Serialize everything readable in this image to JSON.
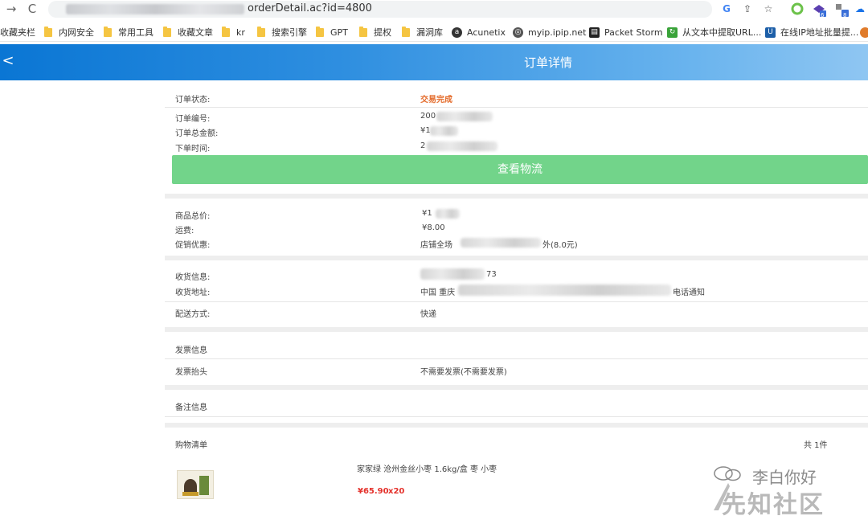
{
  "browser": {
    "url_visible": "orderDetail.ac?id=4800",
    "nav": {
      "forward": "→",
      "reload": "C"
    },
    "badges": {
      "ext1": "6",
      "ext2": "8"
    }
  },
  "bookmarks": [
    {
      "label": "收藏夹栏",
      "icon": "none"
    },
    {
      "label": "内网安全",
      "icon": "folder"
    },
    {
      "label": "常用工具",
      "icon": "folder"
    },
    {
      "label": "收藏文章",
      "icon": "folder"
    },
    {
      "label": "kr",
      "icon": "folder"
    },
    {
      "label": "搜索引擎",
      "icon": "folder"
    },
    {
      "label": "GPT",
      "icon": "folder"
    },
    {
      "label": "提权",
      "icon": "folder"
    },
    {
      "label": "漏洞库",
      "icon": "folder"
    },
    {
      "label": "Acunetix",
      "icon": "acunetix-icon"
    },
    {
      "label": "myip.ipip.net",
      "icon": "globe-icon"
    },
    {
      "label": "Packet Storm",
      "icon": "packetstorm-icon"
    },
    {
      "label": "从文本中提取URL...",
      "icon": "green-icon"
    },
    {
      "label": "在线IP地址批量提...",
      "icon": "u-icon"
    }
  ],
  "header": {
    "title": "订单详情",
    "back": "<"
  },
  "order": {
    "status_label": "订单状态:",
    "status_value": "交易完成",
    "number_label": "订单编号:",
    "number_value": "200",
    "total_label": "订单总金额:",
    "total_value": "¥1",
    "time_label": "下单时间:",
    "time_value": "2",
    "logistics_button": "查看物流"
  },
  "pricing": {
    "goods_total_label": "商品总价:",
    "goods_total_value": "¥1",
    "shipping_label": "运费:",
    "shipping_value": "¥8.00",
    "promo_label": "促销优惠:",
    "promo_prefix": "店铺全场",
    "promo_suffix": "外(8.0元)"
  },
  "delivery": {
    "receiver_label": "收货信息:",
    "receiver_suffix": "73",
    "address_label": "收货地址:",
    "address_prefix": "中国 重庆",
    "address_suffix": "电话通知",
    "method_label": "配送方式:",
    "method_value": "快递"
  },
  "invoice": {
    "section_title": "发票信息",
    "header_label": "发票抬头",
    "header_value": "不需要发票(不需要发票)"
  },
  "remark": {
    "section_title": "备注信息"
  },
  "cart": {
    "section_title": "购物清单",
    "count": "共 1件",
    "item_name": "家家绿 沧州金丝小枣 1.6kg/盒 枣 小枣",
    "item_price": "¥65.90",
    "item_qty": "x20"
  },
  "watermark": {
    "account": "李白你好",
    "site": "先知社区"
  }
}
